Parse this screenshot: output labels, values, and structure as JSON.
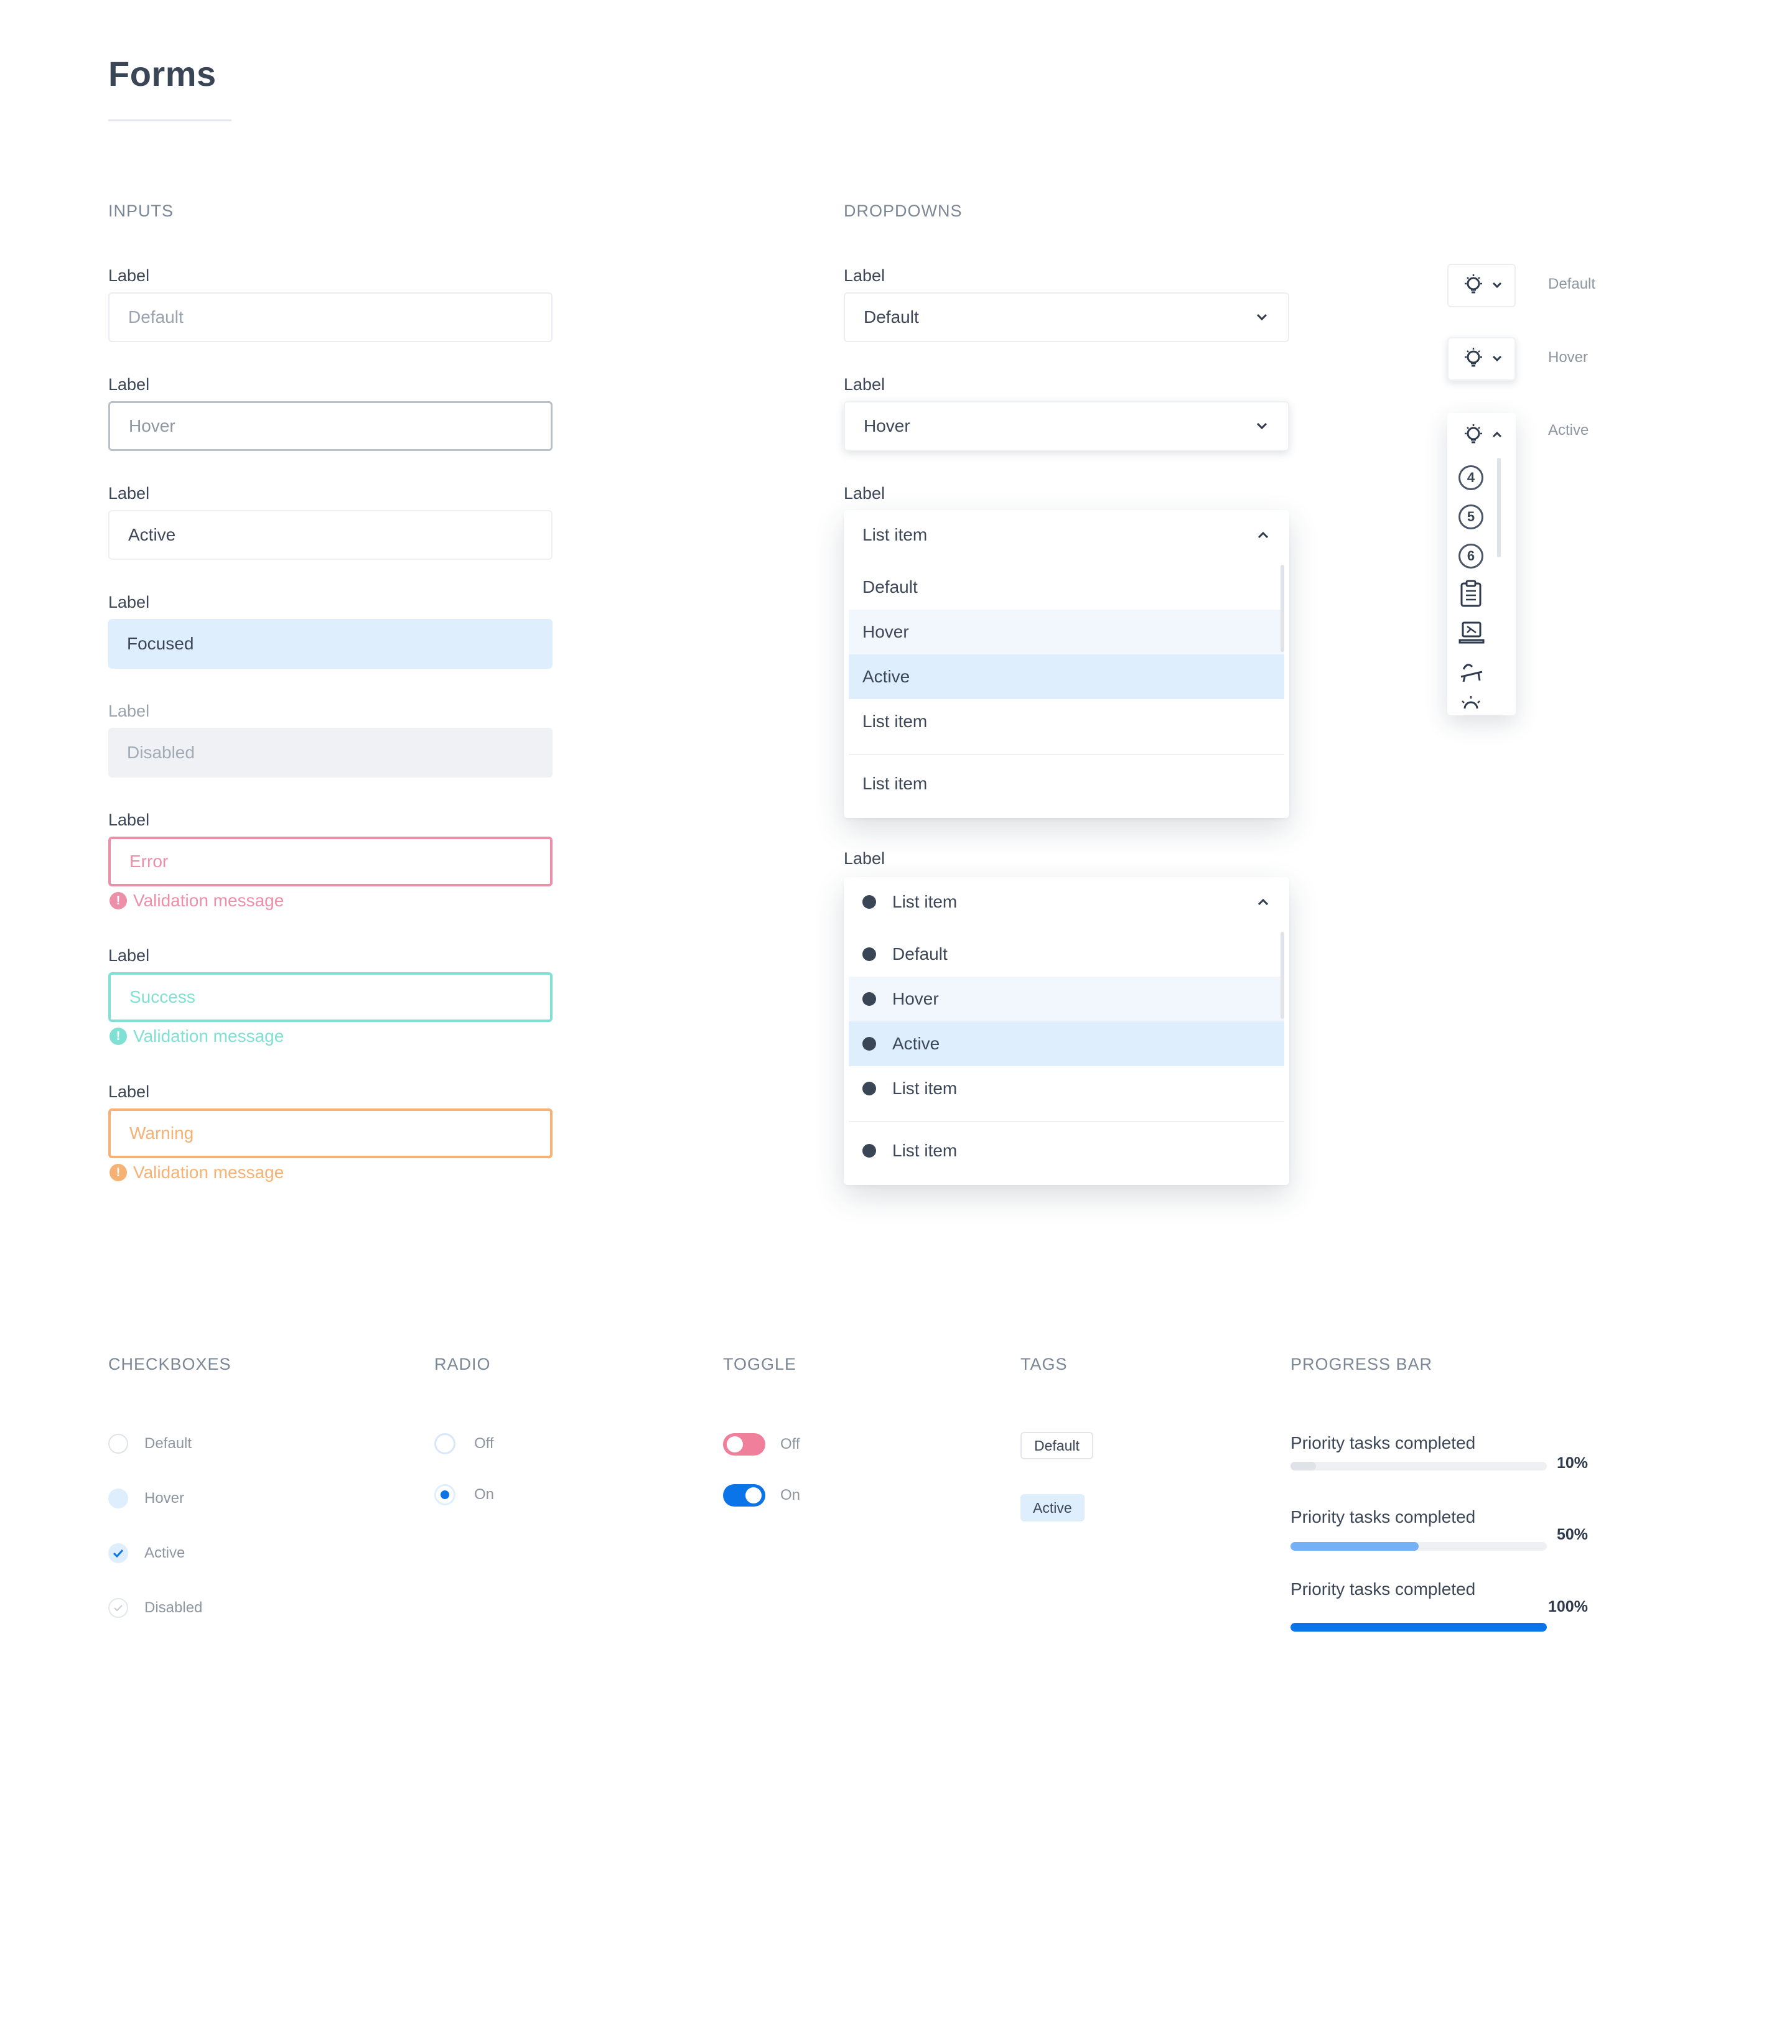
{
  "page": {
    "title": "Forms"
  },
  "sections": {
    "inputs": "INPUTS",
    "dropdowns": "DROPDOWNS",
    "checkboxes": "CHECKBOXES",
    "radio": "RADIO",
    "toggle": "TOGGLE",
    "tags": "TAGS",
    "progress": "PROGRESS BAR"
  },
  "inputs": [
    {
      "label": "Label",
      "value": "Default",
      "state": "default"
    },
    {
      "label": "Label",
      "value": "Hover",
      "state": "hover"
    },
    {
      "label": "Label",
      "value": "Active",
      "state": "active"
    },
    {
      "label": "Label",
      "value": "Focused",
      "state": "focused"
    },
    {
      "label": "Label",
      "value": "Disabled",
      "state": "disabled"
    },
    {
      "label": "Label",
      "value": "Error",
      "state": "error",
      "message": "Validation message"
    },
    {
      "label": "Label",
      "value": "Success",
      "state": "success",
      "message": "Validation message"
    },
    {
      "label": "Label",
      "value": "Warning",
      "state": "warning",
      "message": "Validation message"
    }
  ],
  "dropdowns": {
    "default": {
      "label": "Label",
      "value": "Default"
    },
    "hover": {
      "label": "Label",
      "value": "Hover"
    },
    "open_menu": {
      "label": "Label",
      "selected": "List item",
      "items": [
        "Default",
        "Hover",
        "Active",
        "List item"
      ],
      "footer_item": "List item"
    },
    "bullet_menu": {
      "label": "Label",
      "selected": "List item",
      "items": [
        "Default",
        "Hover",
        "Active",
        "List item"
      ],
      "footer_item": "List item"
    }
  },
  "icon_dropdowns": {
    "states": [
      "Default",
      "Hover",
      "Active"
    ],
    "icon": "lightbulb-icon",
    "menu_numbers": [
      "4",
      "5",
      "6"
    ],
    "menu_icons": [
      "clipboard-icon",
      "laptop-icon",
      "sunbed-icon",
      "sun-icon"
    ]
  },
  "checkboxes": [
    {
      "label": "Default",
      "state": "default"
    },
    {
      "label": "Hover",
      "state": "hover"
    },
    {
      "label": "Active",
      "state": "active"
    },
    {
      "label": "Disabled",
      "state": "disabled"
    }
  ],
  "radio": [
    {
      "label": "Off",
      "state": "off"
    },
    {
      "label": "On",
      "state": "on"
    }
  ],
  "toggle": [
    {
      "label": "Off",
      "state": "off"
    },
    {
      "label": "On",
      "state": "on"
    }
  ],
  "tags": [
    {
      "label": "Default"
    },
    {
      "label": "Active"
    }
  ],
  "progress": [
    {
      "label": "Priority tasks completed",
      "value": 10,
      "text": "10%",
      "color": "#dfe3e8"
    },
    {
      "label": "Priority tasks completed",
      "value": 50,
      "text": "50%",
      "color": "#74b0f6"
    },
    {
      "label": "Priority tasks completed",
      "value": 100,
      "text": "100%",
      "color": "#0c74e9"
    }
  ],
  "colors": {
    "accent": "#0c74e9",
    "focus_bg": "#deeefd",
    "error": "#ee8fa9",
    "success": "#7fe0d3",
    "warning": "#f6b174"
  }
}
